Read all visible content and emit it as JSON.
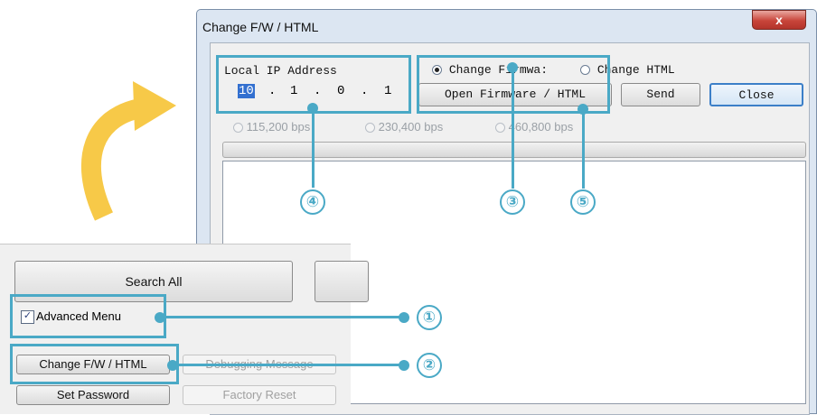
{
  "dialog": {
    "title": "Change F/W / HTML",
    "close_x": "x",
    "ip_label": "Local IP Address",
    "ip_octets": [
      "10",
      "1",
      "0",
      "1"
    ],
    "ip_sep": ".",
    "radio_firmware": "Change Firmwa:",
    "radio_html": "Change HTML",
    "open_button": "Open Firmware / HTML",
    "send_button": "Send",
    "close_button": "Close",
    "baud_options": [
      "115,200 bps",
      "230,400 bps",
      "460,800 bps"
    ]
  },
  "panel": {
    "search_all": "Search All",
    "advanced_menu": "Advanced Menu",
    "advanced_checked": "✓",
    "change_fw_html": "Change F/W / HTML",
    "debugging_message": "Debugging Message",
    "set_password": "Set Password",
    "factory_reset": "Factory Reset"
  },
  "callouts": [
    "①",
    "②",
    "③",
    "④",
    "⑤"
  ],
  "colors": {
    "callout": "#4aa9c6",
    "arrow": "#f7c948"
  }
}
